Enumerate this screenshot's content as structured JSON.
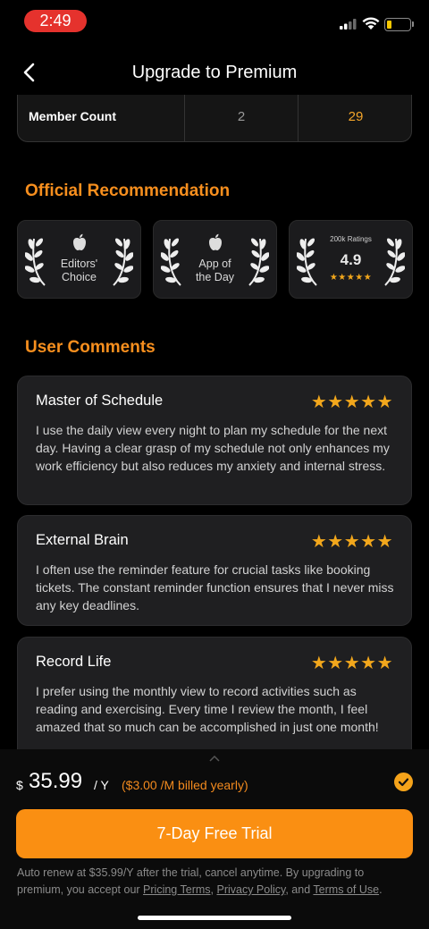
{
  "status_bar": {
    "time": "2:49"
  },
  "nav": {
    "title": "Upgrade to Premium"
  },
  "member_count": {
    "label": "Member Count",
    "free_value": "2",
    "premium_value": "29"
  },
  "recommendation": {
    "title": "Official Recommendation",
    "badges": [
      {
        "line1": "Editors'",
        "line2": "Choice"
      },
      {
        "line1": "App of",
        "line2": "the Day"
      },
      {
        "ratings_label": "200k Ratings",
        "score": "4.9",
        "stars": "★★★★★"
      }
    ]
  },
  "comments": {
    "title": "User Comments",
    "items": [
      {
        "title": "Master of Schedule",
        "stars": "★★★★★",
        "body": "I use the daily view every night to plan my schedule for the next day. Having a clear grasp of my schedule not only enhances my work efficiency but also reduces my anxiety and internal stress."
      },
      {
        "title": "External Brain",
        "stars": "★★★★★",
        "body": "I often use the reminder feature for crucial tasks like booking tickets. The constant reminder function ensures that I never miss any key deadlines."
      },
      {
        "title": "Record Life",
        "stars": "★★★★★",
        "body": "I prefer using the monthly view to record activities such as reading and exercising. Every time I review the month, I feel amazed that so much can be accomplished in just one month!"
      }
    ]
  },
  "purchase": {
    "currency": "$",
    "price": "35.99",
    "unit": "/ Y",
    "monthly_note": "($3.00 /M billed yearly)",
    "cta_label": "7-Day Free Trial",
    "legal": {
      "text1": "Auto renew at $35.99/Y after the trial, cancel anytime. By upgrading to premium, you accept our ",
      "pricing_terms": "Pricing Terms",
      "sep1": ", ",
      "privacy_policy": "Privacy Policy",
      "sep2": ", and ",
      "terms_of_use": "Terms of Use",
      "end": "."
    }
  },
  "colors": {
    "accent": "#fa8f12",
    "heading": "#f78f1e",
    "star": "#f2a71c",
    "card_bg": "#1f1f21",
    "background": "#000000"
  }
}
